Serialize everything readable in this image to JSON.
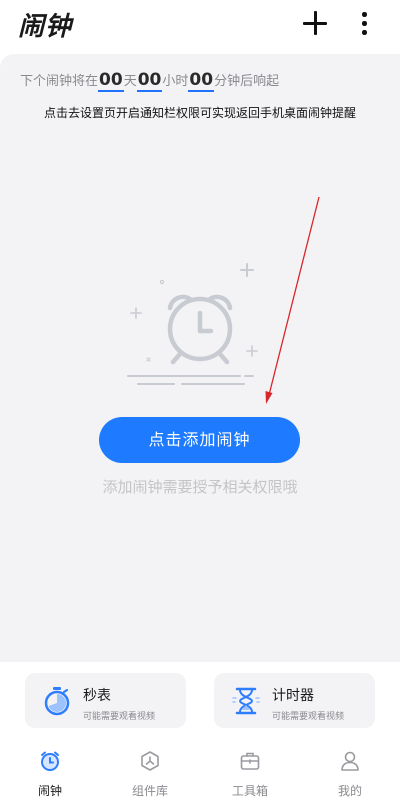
{
  "header": {
    "title": "闹钟",
    "add_icon": "plus-icon",
    "more_icon": "more-vertical-icon"
  },
  "countdown": {
    "prefix": "下个闹钟将在",
    "days": "00",
    "days_unit": "天",
    "hours": "00",
    "hours_unit": "小时",
    "minutes": "00",
    "suffix": "分钟后响起"
  },
  "notice": "点击去设置页开启通知栏权限可实现返回手机桌面闹钟提醒",
  "empty_state": {
    "illustration_icon": "alarm-clock-icon",
    "button_label": "点击添加闹钟",
    "hint": "添加闹钟需要授予相关权限哦"
  },
  "cards": [
    {
      "title": "秒表",
      "subtitle": "可能需要观看视频",
      "icon": "stopwatch-icon"
    },
    {
      "title": "计时器",
      "subtitle": "可能需要观看视频",
      "icon": "hourglass-icon"
    }
  ],
  "nav": [
    {
      "label": "闹钟",
      "icon": "alarm-clock-icon",
      "active": true
    },
    {
      "label": "组件库",
      "icon": "widget-icon",
      "active": false
    },
    {
      "label": "工具箱",
      "icon": "toolbox-icon",
      "active": false
    },
    {
      "label": "我的",
      "icon": "user-icon",
      "active": false
    }
  ],
  "colors": {
    "accent": "#1e7bff",
    "panel_bg": "#f3f3f5",
    "annotation_arrow": "#d9262a"
  }
}
